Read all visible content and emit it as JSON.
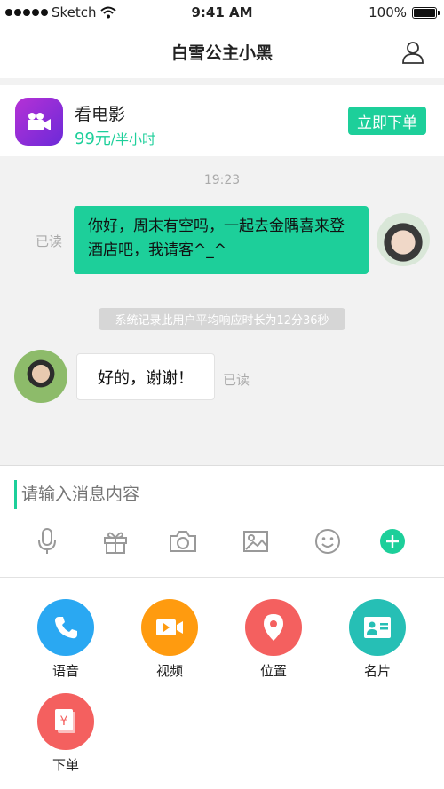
{
  "status_bar": {
    "carrier": "Sketch",
    "time": "9:41 AM",
    "battery": "100%"
  },
  "header": {
    "title": "白雪公主小黑",
    "user_icon": "user-icon"
  },
  "service_card": {
    "icon": "video-camera-icon",
    "title": "看电影",
    "price": "99元",
    "unit": "/半小时",
    "order_button": "立即下单"
  },
  "chat": {
    "timestamp": "19:23",
    "outgoing": {
      "text": "你好，周末有空吗，一起去金隅喜来登酒店吧，我请客^_^",
      "read_label": "已读"
    },
    "system_notice": "系统记录此用户平均响应时长为12分36秒",
    "incoming": {
      "text": "好的，谢谢！",
      "read_label": "已读"
    }
  },
  "input": {
    "placeholder": "请输入消息内容"
  },
  "toolbar": {
    "icons": [
      "microphone-icon",
      "gift-icon",
      "camera-icon",
      "image-icon",
      "emoji-icon",
      "plus-icon"
    ]
  },
  "actions": [
    {
      "label": "语音",
      "icon": "phone-icon",
      "color": "#2aa8f2"
    },
    {
      "label": "视频",
      "icon": "video-icon",
      "color": "#ff9b0f"
    },
    {
      "label": "位置",
      "icon": "location-pin-icon",
      "color": "#f4605f"
    },
    {
      "label": "名片",
      "icon": "contact-card-icon",
      "color": "#26bfb5"
    },
    {
      "label": "下单",
      "icon": "order-receipt-icon",
      "color": "#f4605f"
    }
  ],
  "colors": {
    "accent": "#1dcf9a"
  }
}
